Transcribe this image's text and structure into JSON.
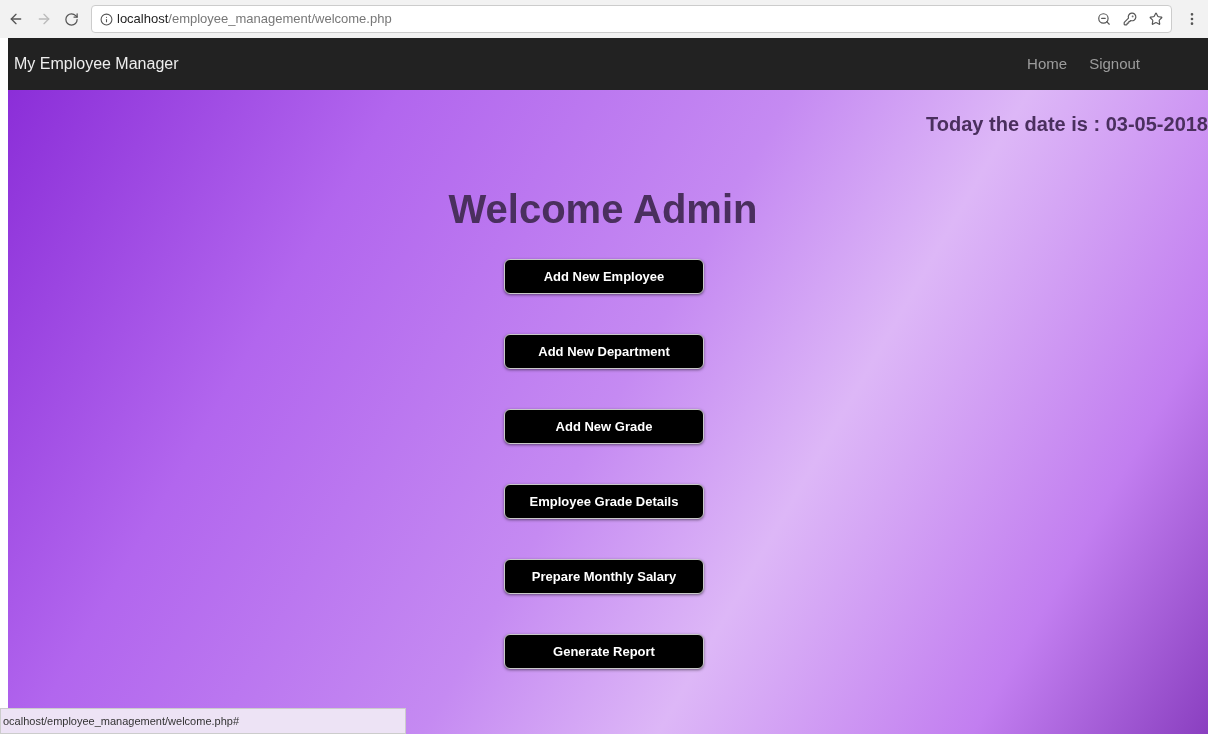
{
  "browser": {
    "url_host": "localhost",
    "url_path": "/employee_management/welcome.php"
  },
  "navbar": {
    "brand": "My Employee Manager",
    "links": [
      "Home",
      "Signout"
    ]
  },
  "date_text": "Today the date is : 03-05-2018",
  "heading": "Welcome Admin",
  "buttons": [
    "Add New Employee",
    "Add New Department",
    "Add New Grade",
    "Employee Grade Details",
    "Prepare Monthly Salary",
    "Generate Report"
  ],
  "status_bar": {
    "url": "ocalhost/employee_management/welcome.php#"
  }
}
